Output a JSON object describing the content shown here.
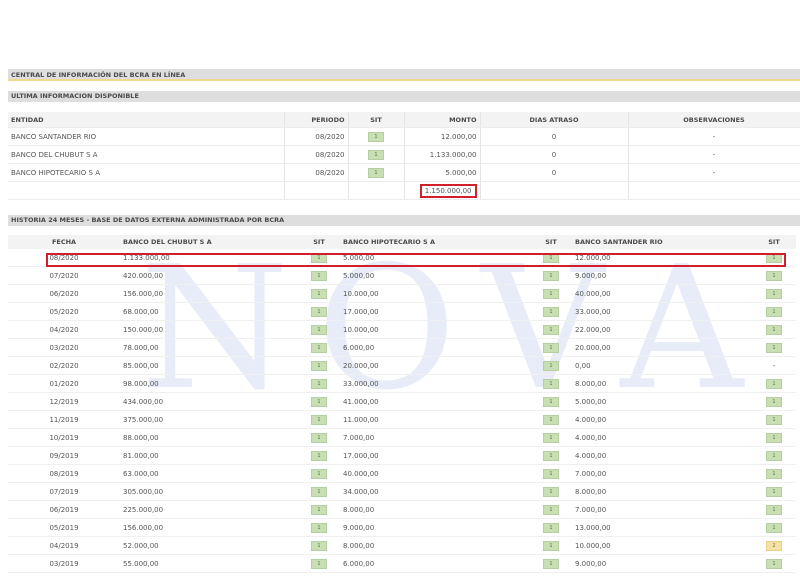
{
  "watermark": "NOVA",
  "title": "CENTRAL DE INFORMACIÓN DEL BCRA EN LÍNEA",
  "summary": {
    "heading": "ULTIMA INFORMACION DISPONIBLE",
    "headers": [
      "ENTIDAD",
      "PERIODO",
      "SIT",
      "MONTO",
      "DIAS ATRASO",
      "OBSERVACIONES"
    ],
    "rows": [
      {
        "entidad": "BANCO SANTANDER RIO",
        "periodo": "08/2020",
        "sit": "1",
        "monto": "12.000,00",
        "dias": "0",
        "obs": "-"
      },
      {
        "entidad": "BANCO DEL CHUBUT S A",
        "periodo": "08/2020",
        "sit": "1",
        "monto": "1.133.000,00",
        "dias": "0",
        "obs": "-"
      },
      {
        "entidad": "BANCO HIPOTECARIO S A",
        "periodo": "08/2020",
        "sit": "1",
        "monto": "5.000,00",
        "dias": "0",
        "obs": "-"
      }
    ],
    "total": "1.150.000,00"
  },
  "history": {
    "heading": "HISTORIA 24 MESES - BASE DE DATOS EXTERNA ADMINISTRADA POR BCRA",
    "headers": [
      "FECHA",
      "BANCO DEL CHUBUT S A",
      "SIT",
      "BANCO HIPOTECARIO S A",
      "SIT",
      "BANCO SANTANDER RIO",
      "SIT"
    ],
    "rows": [
      {
        "fecha": "08/2020",
        "chubut": "1.133.000,00",
        "s1": "1",
        "hipo": "5.000,00",
        "s2": "1",
        "sant": "12.000,00",
        "s3": "1"
      },
      {
        "fecha": "07/2020",
        "chubut": "420.000,00",
        "s1": "1",
        "hipo": "5.000,00",
        "s2": "1",
        "sant": "9.000,00",
        "s3": "1"
      },
      {
        "fecha": "06/2020",
        "chubut": "156.000,00",
        "s1": "1",
        "hipo": "10.000,00",
        "s2": "1",
        "sant": "40.000,00",
        "s3": "1"
      },
      {
        "fecha": "05/2020",
        "chubut": "68.000,00",
        "s1": "1",
        "hipo": "17.000,00",
        "s2": "1",
        "sant": "33.000,00",
        "s3": "1"
      },
      {
        "fecha": "04/2020",
        "chubut": "150.000,00",
        "s1": "1",
        "hipo": "10.000,00",
        "s2": "1",
        "sant": "22.000,00",
        "s3": "1"
      },
      {
        "fecha": "03/2020",
        "chubut": "78.000,00",
        "s1": "1",
        "hipo": "6.000,00",
        "s2": "1",
        "sant": "20.000,00",
        "s3": "1"
      },
      {
        "fecha": "02/2020",
        "chubut": "85.000,00",
        "s1": "1",
        "hipo": "20.000,00",
        "s2": "1",
        "sant": "0,00",
        "s3": "-"
      },
      {
        "fecha": "01/2020",
        "chubut": "98.000,00",
        "s1": "1",
        "hipo": "33.000,00",
        "s2": "1",
        "sant": "8.000,00",
        "s3": "1"
      },
      {
        "fecha": "12/2019",
        "chubut": "434.000,00",
        "s1": "1",
        "hipo": "41.000,00",
        "s2": "1",
        "sant": "5.000,00",
        "s3": "1"
      },
      {
        "fecha": "11/2019",
        "chubut": "375.000,00",
        "s1": "1",
        "hipo": "11.000,00",
        "s2": "1",
        "sant": "4.000,00",
        "s3": "1"
      },
      {
        "fecha": "10/2019",
        "chubut": "88.000,00",
        "s1": "1",
        "hipo": "7.000,00",
        "s2": "1",
        "sant": "4.000,00",
        "s3": "1"
      },
      {
        "fecha": "09/2019",
        "chubut": "81.000,00",
        "s1": "1",
        "hipo": "17.000,00",
        "s2": "1",
        "sant": "4.000,00",
        "s3": "1"
      },
      {
        "fecha": "08/2019",
        "chubut": "63.000,00",
        "s1": "1",
        "hipo": "40.000,00",
        "s2": "1",
        "sant": "7.000,00",
        "s3": "1"
      },
      {
        "fecha": "07/2019",
        "chubut": "305.000,00",
        "s1": "1",
        "hipo": "34.000,00",
        "s2": "1",
        "sant": "8.000,00",
        "s3": "1"
      },
      {
        "fecha": "06/2019",
        "chubut": "225.000,00",
        "s1": "1",
        "hipo": "8.000,00",
        "s2": "1",
        "sant": "7.000,00",
        "s3": "1"
      },
      {
        "fecha": "05/2019",
        "chubut": "156.000,00",
        "s1": "1",
        "hipo": "9.000,00",
        "s2": "1",
        "sant": "13.000,00",
        "s3": "1"
      },
      {
        "fecha": "04/2019",
        "chubut": "52.000,00",
        "s1": "1",
        "hipo": "8.000,00",
        "s2": "1",
        "sant": "10.000,00",
        "s3": "2"
      },
      {
        "fecha": "03/2019",
        "chubut": "55.000,00",
        "s1": "1",
        "hipo": "6.000,00",
        "s2": "1",
        "sant": "9.000,00",
        "s3": "1"
      }
    ]
  },
  "colors": {
    "highlight": "#d0202a",
    "sit_1": "#c7dfb3",
    "sit_2": "#f6e2a6",
    "header_bar": "#dedede",
    "accent_line": "#f0d98a"
  }
}
